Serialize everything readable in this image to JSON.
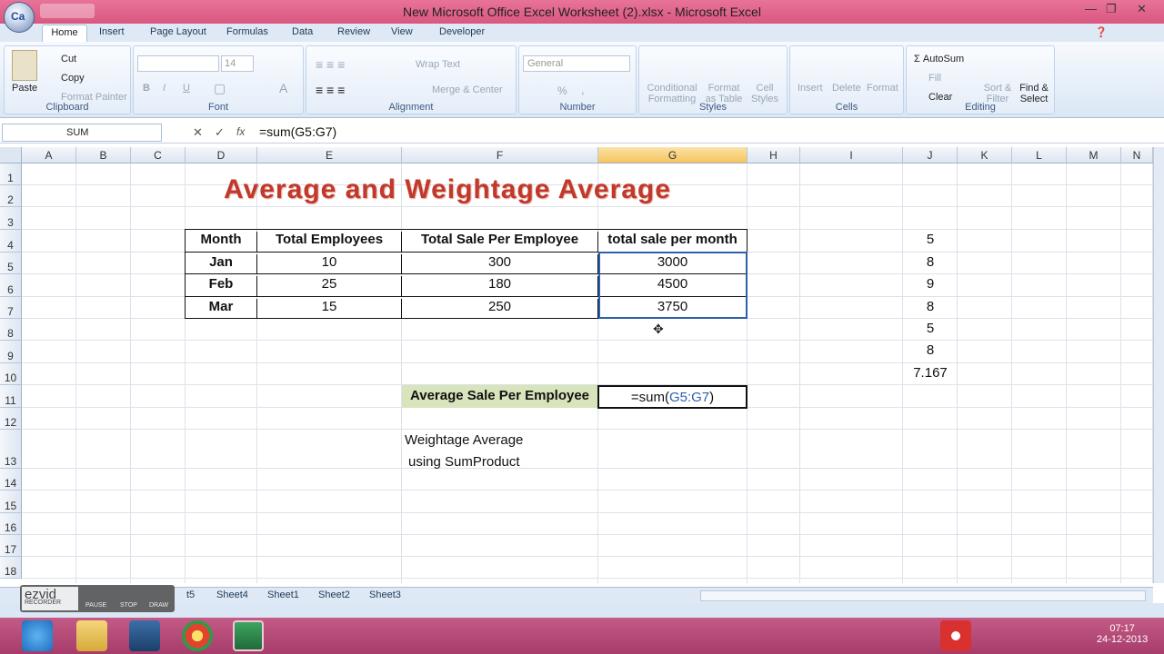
{
  "window": {
    "title": "New Microsoft Office Excel Worksheet (2).xlsx - Microsoft Excel",
    "orb_label": "Ca",
    "controls": [
      "—",
      "❐",
      "✕"
    ]
  },
  "ribbon_tabs": [
    "Home",
    "Insert",
    "Page Layout",
    "Formulas",
    "Data",
    "Review",
    "View",
    "Developer"
  ],
  "ribbon": {
    "clipboard": {
      "label": "Clipboard",
      "paste": "Paste",
      "cut": "Cut",
      "copy": "Copy",
      "format_painter": "Format Painter"
    },
    "font": {
      "label": "Font",
      "size": "14"
    },
    "alignment": {
      "label": "Alignment",
      "wrap": "Wrap Text",
      "merge": "Merge & Center"
    },
    "number": {
      "label": "Number",
      "format": "General",
      "percent": "%",
      "comma": ","
    },
    "styles": {
      "label": "Styles",
      "cond": "Conditional Formatting",
      "table": "Format as Table",
      "cell": "Cell Styles"
    },
    "cells": {
      "label": "Cells",
      "insert": "Insert",
      "delete": "Delete",
      "format": "Format"
    },
    "editing": {
      "label": "Editing",
      "autosum": "AutoSum",
      "fill": "Fill",
      "clear": "Clear",
      "sort": "Sort & Filter",
      "find": "Find & Select"
    }
  },
  "formula_bar": {
    "name_box": "SUM",
    "formula": "=sum(G5:G7)"
  },
  "columns": [
    "A",
    "B",
    "C",
    "D",
    "E",
    "F",
    "G",
    "H",
    "I",
    "J",
    "K",
    "L",
    "M",
    "N"
  ],
  "rows": [
    "1",
    "2",
    "3",
    "4",
    "5",
    "6",
    "7",
    "8",
    "9",
    "10",
    "11",
    "12",
    "13",
    "14",
    "15",
    "16",
    "17",
    "18"
  ],
  "sheet": {
    "title": "Average and Weightage Average",
    "headers": [
      "Month",
      "Total Employees",
      "Total Sale Per Employee",
      "total sale per month"
    ],
    "table": [
      [
        "Jan",
        "10",
        "300",
        "3000"
      ],
      [
        "Feb",
        "25",
        "180",
        "4500"
      ],
      [
        "Mar",
        "15",
        "250",
        "3750"
      ]
    ],
    "j_values": [
      "5",
      "8",
      "9",
      "8",
      "5",
      "8",
      "7.167"
    ],
    "avg_label": "Average Sale Per Employee",
    "avg_formula_prefix": "=sum(",
    "avg_formula_ref": "G5:G7",
    "avg_formula_suffix": ")",
    "note_line1": "Weightage Average",
    "note_line2": "using SumProduct"
  },
  "sheet_tabs": [
    "t5",
    "Sheet4",
    "Sheet1",
    "Sheet2",
    "Sheet3"
  ],
  "ezvid": {
    "logo": "ezvid",
    "sub": "RECORDER",
    "buttons": [
      "PAUSE",
      "STOP",
      "DRAW"
    ]
  },
  "tray": {
    "time": "07:17",
    "date": "24-12-2013"
  },
  "colors": {
    "title_red": "#c0392b",
    "avg_label_bg": "#d8e4bc",
    "selected_col": "#f9d99a",
    "title_bar": "#d9577f"
  }
}
